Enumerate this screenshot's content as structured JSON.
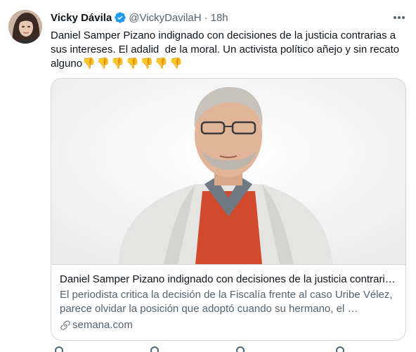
{
  "tweet": {
    "author_name": "Vicky Dávila",
    "handle": "@VickyDavilaH",
    "separator": "·",
    "time": "18h",
    "text": "Daniel Samper Pizano indignado con decisiones de la justicia contrarias a sus intereses. El adalid  de la moral. Un activista político añejo y sin recato alguno",
    "emojis": "👎👎👎👎👎👎👎",
    "icons": {
      "verified": "verified-badge-icon",
      "more": "more-options-icon",
      "link": "link-icon"
    }
  },
  "card": {
    "title": "Daniel Samper Pizano indignado con decisiones de la justicia contraria…",
    "description": "El periodista critica la decisión de la Fiscalía frente al caso Uribe Vélez, parece olvidar la posición que adoptó cuando su hermano, el …",
    "domain": "semana.com"
  },
  "colors": {
    "text": "#0f1419",
    "secondary": "#536471",
    "verified": "#1d9bf0",
    "border": "#cfd9de"
  }
}
